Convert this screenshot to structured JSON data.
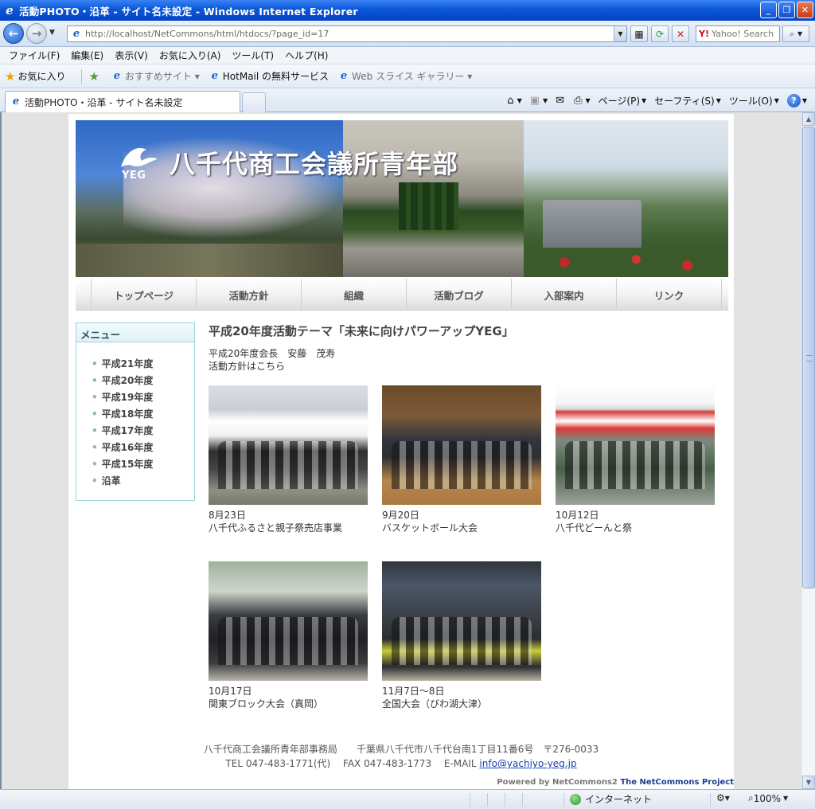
{
  "window": {
    "title": "活動PHOTO・沿革 - サイト名未設定 - Windows Internet Explorer"
  },
  "address": {
    "url": "http://localhost/NetCommons/html/htdocs/?page_id=17",
    "search_placeholder": "Yahoo! Search"
  },
  "menubar": [
    "ファイル(F)",
    "編集(E)",
    "表示(V)",
    "お気に入り(A)",
    "ツール(T)",
    "ヘルプ(H)"
  ],
  "favorites": {
    "label": "お気に入り",
    "items": [
      "おすすめサイト ▾",
      "HotMail の無料サービス",
      "Web スライス ギャラリー ▾"
    ]
  },
  "tab": {
    "title": "活動PHOTO・沿革 - サイト名未設定"
  },
  "commandbar": {
    "page": "ページ(P)",
    "safety": "セーフティ(S)",
    "tools": "ツール(O)"
  },
  "site": {
    "title": "八千代商工会議所青年部",
    "logo_text": "YEG"
  },
  "gnav": [
    "トップページ",
    "活動方針",
    "組織",
    "活動ブログ",
    "入部案内",
    "リンク"
  ],
  "sidemenu": {
    "title": "メニュー",
    "items": [
      "平成21年度",
      "平成20年度",
      "平成19年度",
      "平成18年度",
      "平成17年度",
      "平成16年度",
      "平成15年度",
      "沿革"
    ]
  },
  "main": {
    "title": "平成20年度活動テーマ「未来に向けパワーアップYEG」",
    "president": "平成20年度会長　安藤　茂寿",
    "policy_link": "活動方針はこちら",
    "photos": [
      {
        "date": "8月23日",
        "event": "八千代ふるさと親子祭売店事業"
      },
      {
        "date": "9月20日",
        "event": "バスケットボール大会"
      },
      {
        "date": "10月12日",
        "event": "八千代どーんと祭"
      },
      {
        "date": "10月17日",
        "event": "関東ブロック大会（真岡）"
      },
      {
        "date": "11月7日～8日",
        "event": "全国大会（びわ湖大津）"
      }
    ]
  },
  "footer": {
    "line1": "八千代商工会議所青年部事務局　　千葉県八千代市八千代台南1丁目11番6号　〒276-0033",
    "line2_prefix": "TEL 047-483-1771(代)　 FAX 047-483-1773　 E-MAIL ",
    "email": "info@yachiyo-yeg.jp",
    "powered_prefix": "Powered by NetCommons2 ",
    "powered_project": "The NetCommons Project"
  },
  "status": {
    "zone": "インターネット",
    "zoom": "100%"
  }
}
